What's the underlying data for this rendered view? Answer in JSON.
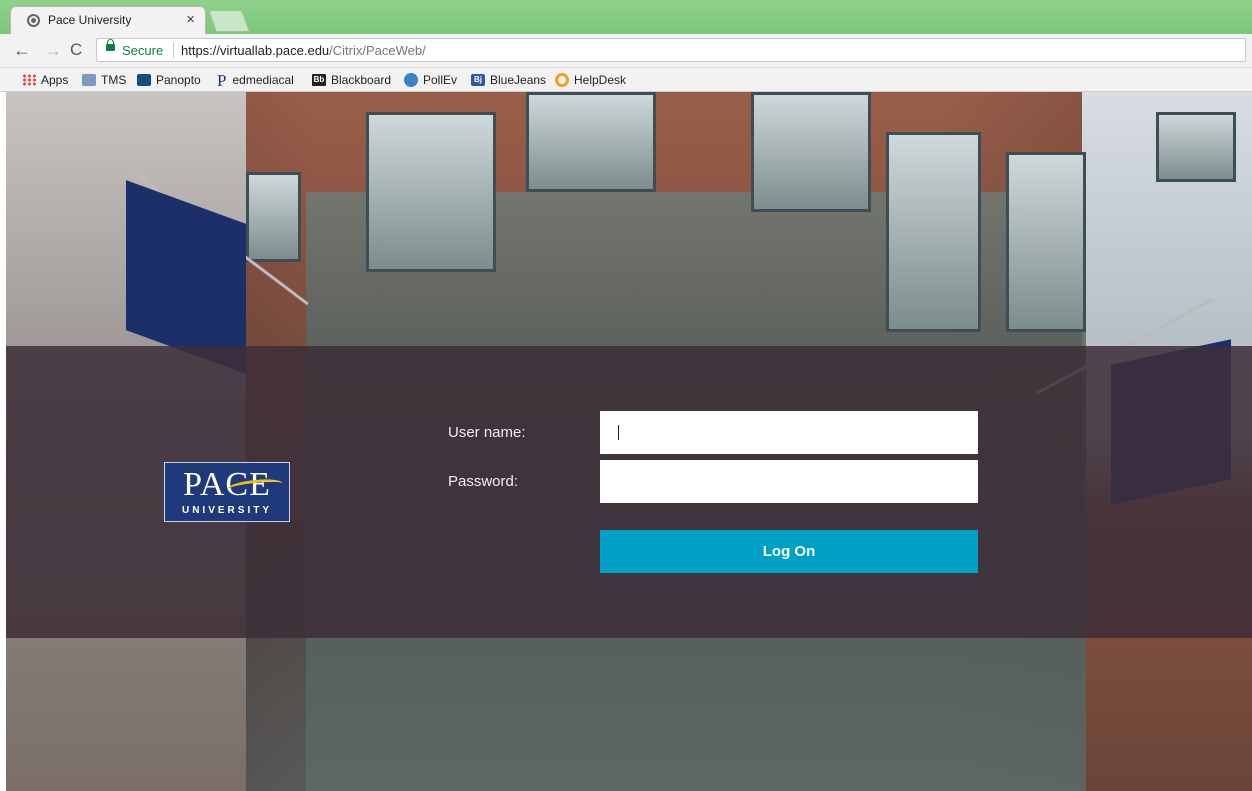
{
  "browser": {
    "tab_title": "Pace University",
    "tab_close": "×",
    "secure_label": "Secure",
    "url_host": "https://virtuallab.pace.edu",
    "url_path": "/Citrix/PaceWeb/",
    "nav": {
      "back": "←",
      "forward": "→",
      "reload": "C"
    }
  },
  "bookmarks": [
    {
      "label": "Apps",
      "icon": "apps-grid-icon"
    },
    {
      "label": "TMS",
      "icon": "cisco-icon"
    },
    {
      "label": "Panopto",
      "icon": "panopto-icon"
    },
    {
      "label": "edmediacal",
      "icon": "p-letter-icon",
      "glyph": "P"
    },
    {
      "label": "Blackboard",
      "icon": "blackboard-icon",
      "glyph": "Bb"
    },
    {
      "label": "PollEv",
      "icon": "pollev-icon"
    },
    {
      "label": "BlueJeans",
      "icon": "bluejeans-icon",
      "glyph": "Bj"
    },
    {
      "label": "HelpDesk",
      "icon": "helpdesk-icon"
    }
  ],
  "logo": {
    "word": "PACE",
    "sub": "UNIVERSITY"
  },
  "login": {
    "username_label": "User name:",
    "password_label": "Password:",
    "username_value": "",
    "password_value": "",
    "submit_label": "Log On"
  },
  "colors": {
    "button": "#00a0c6",
    "band": "#3e2e38",
    "logo_bg": "#1f3a7a"
  }
}
